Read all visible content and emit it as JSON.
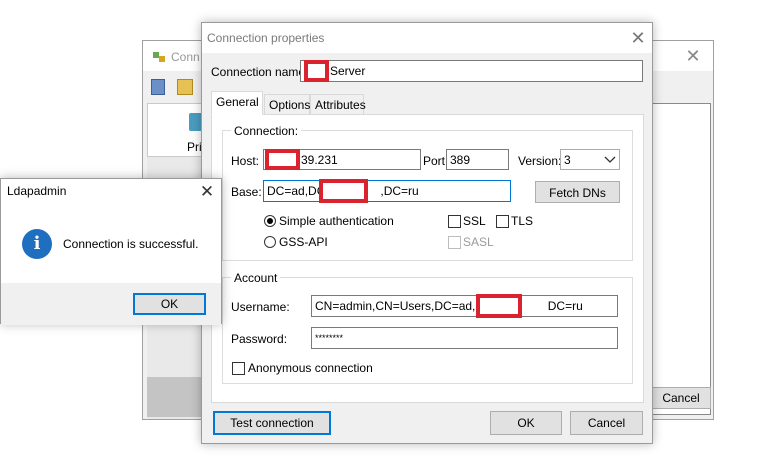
{
  "background_window": {
    "title": "Conn",
    "left_item_label": "Pri",
    "cancel_label": "Cancel"
  },
  "dialog": {
    "title": "Connection properties",
    "connection_name_label": "Connection name:",
    "connection_name_value": "Server",
    "tabs": [
      {
        "label": "General"
      },
      {
        "label": "Options"
      },
      {
        "label": "Attributes"
      }
    ],
    "connection_group": {
      "title": "Connection:",
      "host_label": "Host:",
      "host_value": "39.231",
      "port_label": "Port:",
      "port_value": "389",
      "version_label": "Version:",
      "version_value": "3",
      "base_label": "Base:",
      "base_value_prefix": "DC=ad,DC=",
      "base_value_suffix": ",DC=ru",
      "fetch_dns_label": "Fetch DNs",
      "simple_auth_label": "Simple authentication",
      "gssapi_label": "GSS-API",
      "ssl_label": "SSL",
      "tls_label": "TLS",
      "sasl_label": "SASL"
    },
    "account_group": {
      "title": "Account",
      "username_label": "Username:",
      "username_prefix": "CN=admin,CN=Users,DC=ad,DC=",
      "username_suffix": "DC=ru",
      "password_label": "Password:",
      "password_value": "********",
      "anonymous_label": "Anonymous connection"
    },
    "buttons": {
      "test": "Test connection",
      "ok": "OK",
      "cancel": "Cancel"
    }
  },
  "message_box": {
    "title": "Ldapadmin",
    "icon": "info-icon",
    "message": "Connection is successful.",
    "ok_label": "OK"
  },
  "colors": {
    "redaction": "#d9232f",
    "accent": "#0078d7",
    "info_icon": "#1f6fc1"
  }
}
